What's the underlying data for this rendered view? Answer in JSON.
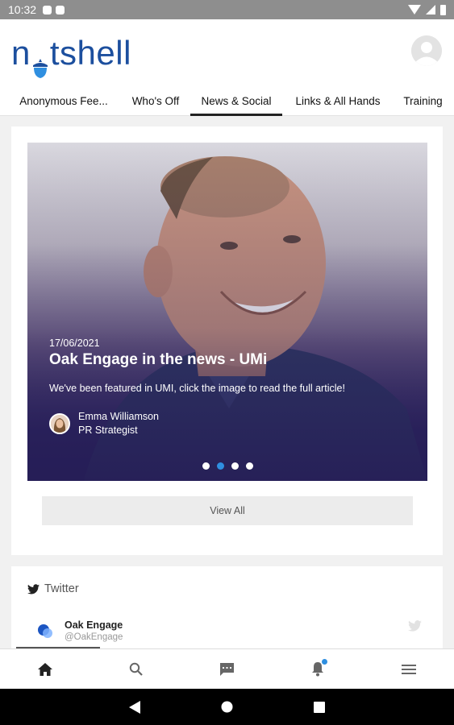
{
  "status_bar": {
    "time": "10:32"
  },
  "app": {
    "logo_text_before": "n",
    "logo_text_after": "tshell"
  },
  "tabs": [
    {
      "label": "Anonymous Fee..."
    },
    {
      "label": "Who's Off"
    },
    {
      "label": "News & Social",
      "active": true
    },
    {
      "label": "Links & All Hands"
    },
    {
      "label": "Training"
    }
  ],
  "news": {
    "date": "17/06/2021",
    "title": "Oak Engage in the news - UMi",
    "description": "We've been featured in UMI, click the image to read the full article!",
    "author_name": "Emma Williamson",
    "author_role": "PR Strategist",
    "carousel_total": 4,
    "carousel_active_index": 1,
    "view_all_label": "View All"
  },
  "twitter": {
    "heading": "Twitter",
    "account_name": "Oak Engage",
    "account_handle": "@OakEngage"
  },
  "bottom_nav": {
    "items": [
      "home-icon",
      "search-icon",
      "chat-icon",
      "bell-icon",
      "menu-icon"
    ],
    "notification_badge": true
  },
  "colors": {
    "brand": "#1c4f9e",
    "accent": "#2f8fe0",
    "hero_overlay": "#261e57"
  }
}
